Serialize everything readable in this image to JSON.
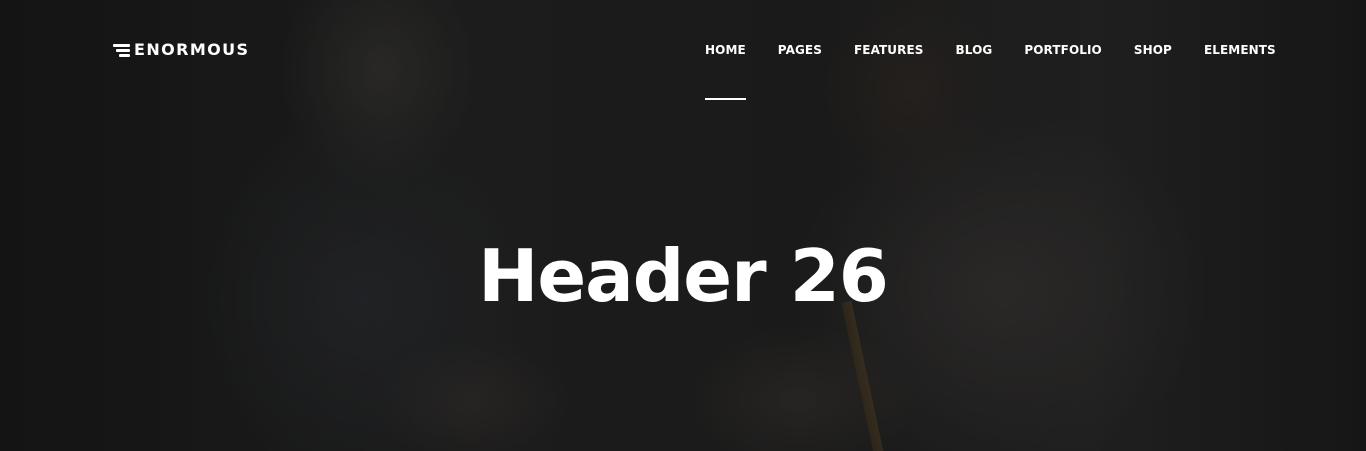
{
  "header": {
    "logo_text": "ENORMOUS",
    "nav": {
      "items": [
        {
          "label": "HOME",
          "active": true
        },
        {
          "label": "PAGES",
          "active": false
        },
        {
          "label": "FEATURES",
          "active": false
        },
        {
          "label": "BLOG",
          "active": false
        },
        {
          "label": "PORTFOLIO",
          "active": false
        },
        {
          "label": "SHOP",
          "active": false
        },
        {
          "label": "ELEMENTS",
          "active": false
        }
      ]
    }
  },
  "hero": {
    "title": "Header 26"
  },
  "colors": {
    "text": "#ffffff",
    "background": "#202020"
  },
  "icons": {
    "logo_mark": "three-speed-lines-icon"
  }
}
